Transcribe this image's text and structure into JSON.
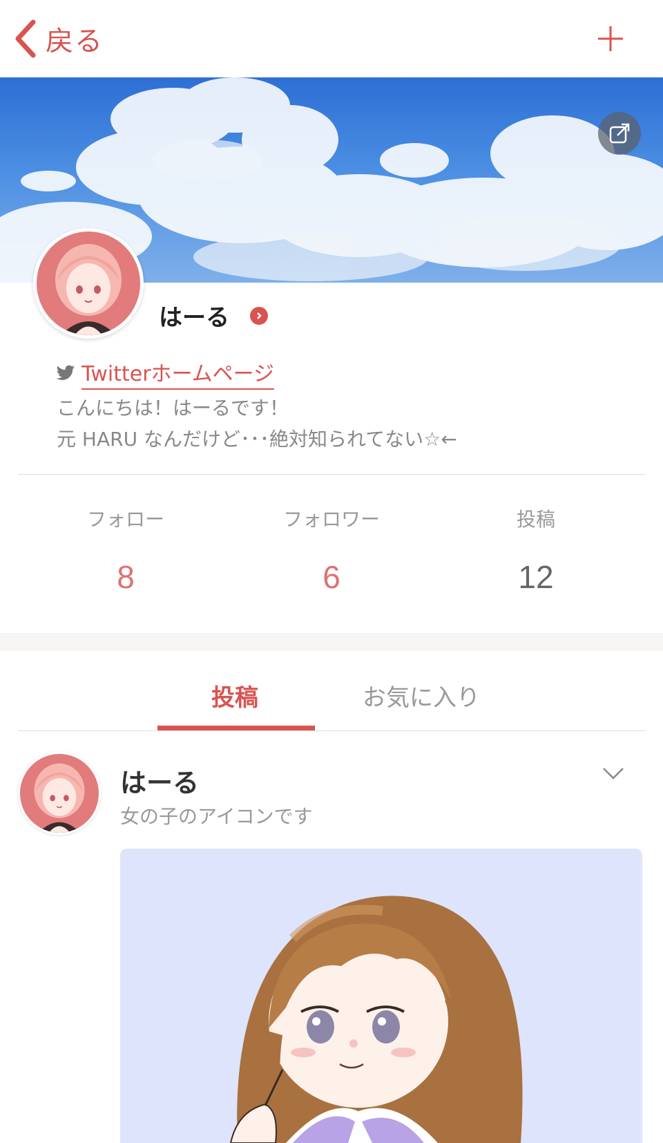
{
  "nav": {
    "back_label": "戻る"
  },
  "profile": {
    "username": "はーる",
    "twitter_link": "Twitterホームページ",
    "bio_line1": "こんにちは！はーるです！",
    "bio_line2": "元 HARU なんだけど･･･絶対知られてない☆←"
  },
  "stats": [
    {
      "label": "フォロー",
      "value": "8"
    },
    {
      "label": "フォロワー",
      "value": "6"
    },
    {
      "label": "投稿",
      "value": "12"
    }
  ],
  "tabs": {
    "posts": "投稿",
    "favorites": "お気に入り"
  },
  "post": {
    "author": "はーる",
    "text": "女の子のアイコンです"
  },
  "colors": {
    "accent": "#d9534f",
    "stat_red": "#e07070",
    "cover_blue": "#3f82dc",
    "post_bg": "#dee4fb"
  },
  "icons": [
    "back-chevron-icon",
    "plus-icon",
    "share-icon",
    "chevron-right-icon",
    "twitter-bird-icon",
    "chevron-down-icon"
  ]
}
